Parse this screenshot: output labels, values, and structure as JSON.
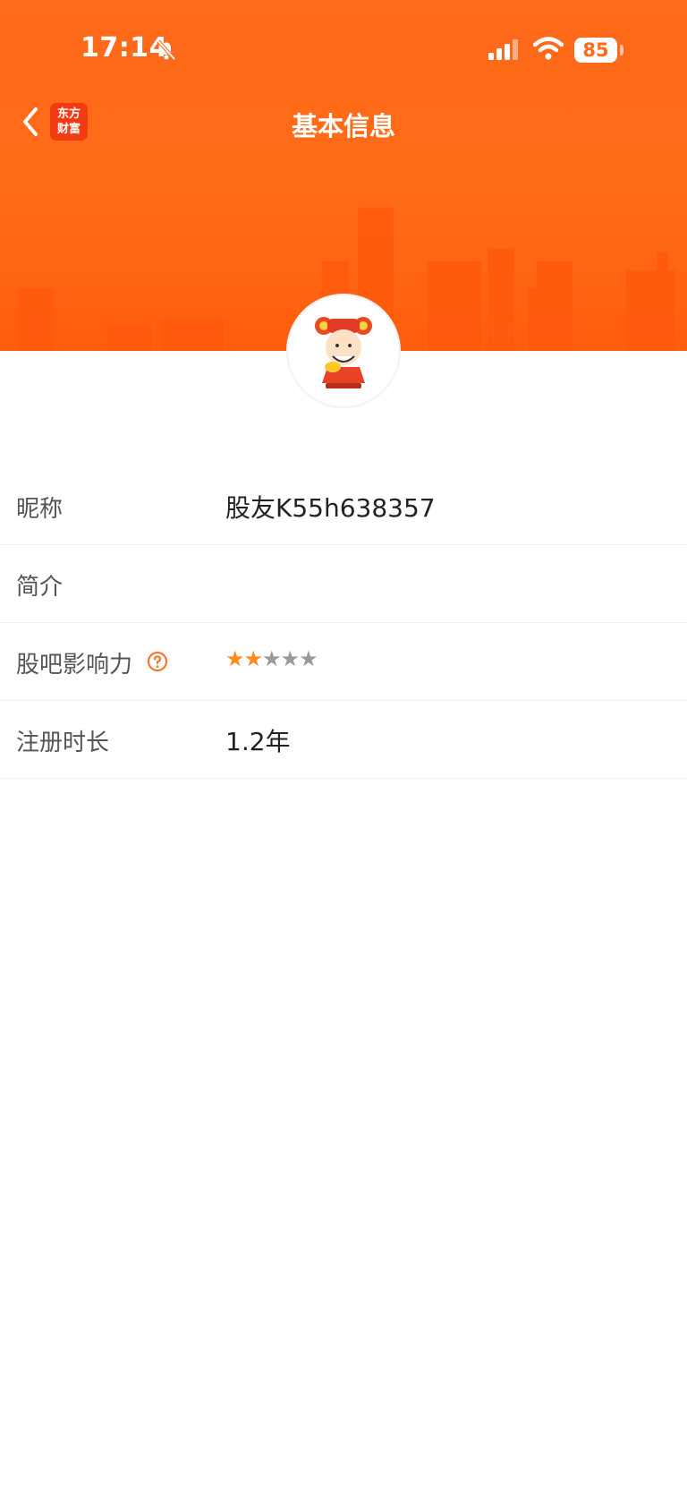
{
  "status_bar": {
    "time": "17:14",
    "battery": "85"
  },
  "header": {
    "title": "基本信息",
    "brand_logo_line1": "东方",
    "brand_logo_line2": "财富"
  },
  "rows": [
    {
      "label": "昵称",
      "value": "股友K55h638357"
    },
    {
      "label": "简介",
      "value": ""
    },
    {
      "label": "股吧影响力",
      "rating": 2,
      "max_rating": 5
    },
    {
      "label": "注册时长",
      "value": "1.2年"
    }
  ],
  "colors": {
    "header_orange": "#ff6a1b",
    "star_active": "#ff8a1d",
    "star_inactive": "#9a9a9a"
  },
  "icons": [
    "back-chevron-icon",
    "mute-bell-icon",
    "signal-icon",
    "wifi-icon",
    "battery-icon",
    "help-icon",
    "star-icon"
  ]
}
